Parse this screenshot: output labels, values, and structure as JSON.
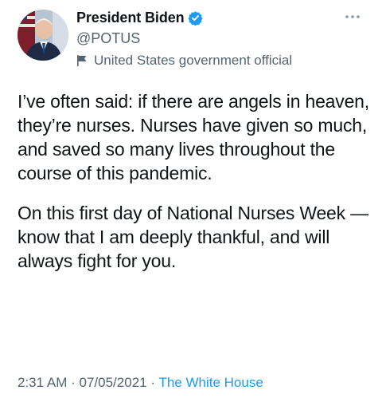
{
  "author": {
    "display_name": "President Biden",
    "handle": "@POTUS",
    "label": "United States government official",
    "verified": true
  },
  "icons": {
    "verified": "verified-badge-icon",
    "label": "flag-icon",
    "more": "more-options-icon",
    "avatar": "profile-photo"
  },
  "colors": {
    "text": "#0f1419",
    "secondary": "#536471",
    "link": "#1d9bf0",
    "verified": "#1d9bf0"
  },
  "tweet": {
    "paragraphs": [
      "I’ve often said: if there are angels in heaven, they’re nurses. Nurses have given so much, and saved so many lives throughout the course of this pandemic.",
      "On this first day of National Nurses Week — know that I am deeply thankful, and will always fight for you."
    ],
    "time": "2:31 AM",
    "date": "07/05/2021",
    "separator": "·",
    "source": "The White House"
  }
}
